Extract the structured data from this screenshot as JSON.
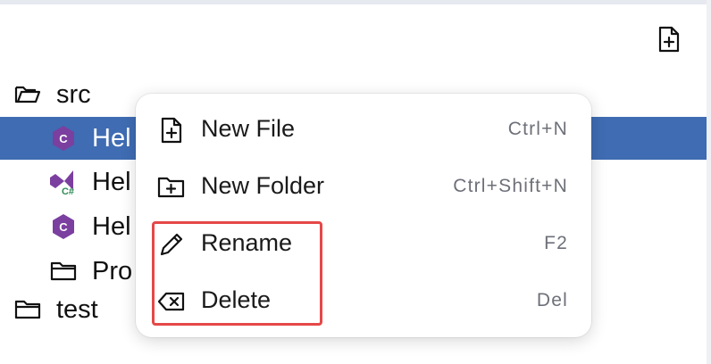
{
  "tree": {
    "items": [
      {
        "label": "src",
        "icon": "folder-open-icon"
      },
      {
        "label": "Hel",
        "icon": "csharp-file-icon",
        "selected": true
      },
      {
        "label": "Hel",
        "icon": "csharp-project-icon"
      },
      {
        "label": "Hel",
        "icon": "csharp-file-icon"
      },
      {
        "label": "Pro",
        "icon": "folder-icon"
      },
      {
        "label": "test",
        "icon": "folder-icon"
      }
    ]
  },
  "context_menu": {
    "items": [
      {
        "label": "New File",
        "shortcut": "Ctrl+N",
        "icon": "new-file-icon"
      },
      {
        "label": "New Folder",
        "shortcut": "Ctrl+Shift+N",
        "icon": "new-folder-icon"
      },
      {
        "label": "Rename",
        "shortcut": "F2",
        "icon": "pencil-icon"
      },
      {
        "label": "Delete",
        "shortcut": "Del",
        "icon": "delete-icon"
      }
    ]
  },
  "colors": {
    "selection": "#3f6cb3",
    "highlight_border": "#e54848",
    "csharp_icon": "#7b3fa0"
  }
}
